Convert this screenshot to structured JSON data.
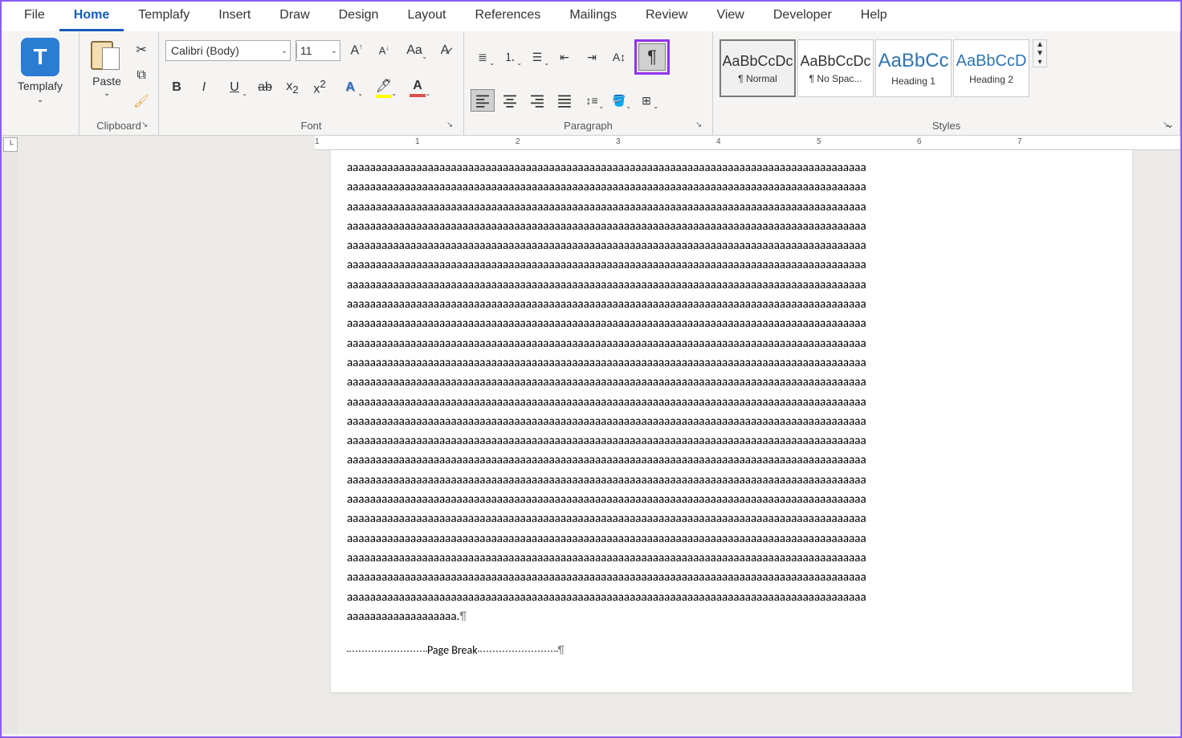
{
  "menu": {
    "items": [
      "File",
      "Home",
      "Templafy",
      "Insert",
      "Draw",
      "Design",
      "Layout",
      "References",
      "Mailings",
      "Review",
      "View",
      "Developer",
      "Help"
    ],
    "active_index": 1
  },
  "ribbon": {
    "templafy": {
      "label": "Templafy"
    },
    "clipboard": {
      "group_label": "Clipboard",
      "paste_label": "Paste"
    },
    "font": {
      "group_label": "Font",
      "font_name": "Calibri (Body)",
      "font_size": "11",
      "case_label": "Aa"
    },
    "paragraph": {
      "group_label": "Paragraph"
    },
    "styles": {
      "group_label": "Styles",
      "items": [
        {
          "preview": "AaBbCcDc",
          "name": "¶ Normal",
          "cls": "",
          "selected": true
        },
        {
          "preview": "AaBbCcDc",
          "name": "¶ No Spac...",
          "cls": "",
          "selected": false
        },
        {
          "preview": "AaBbCc",
          "name": "Heading 1",
          "cls": "h1",
          "selected": false
        },
        {
          "preview": "AaBbCcD",
          "name": "Heading 2",
          "cls": "h2",
          "selected": false
        }
      ]
    }
  },
  "ruler": {
    "marks": [
      {
        "pos": 0,
        "label": "1"
      },
      {
        "pos": 125,
        "label": "1"
      },
      {
        "pos": 250,
        "label": "2"
      },
      {
        "pos": 375,
        "label": "3"
      },
      {
        "pos": 500,
        "label": "4"
      },
      {
        "pos": 625,
        "label": "5"
      },
      {
        "pos": 750,
        "label": "6"
      },
      {
        "pos": 875,
        "label": "7"
      }
    ]
  },
  "document": {
    "line": "aaaaaaaaaaaaaaaaaaaaaaaaaaaaaaaaaaaaaaaaaaaaaaaaaaaaaaaaaaaaaaaaaaaaaaaaaaaaaaaaaaaaaaaaaa",
    "line_count": 23,
    "last_line": "aaaaaaaaaaaaaaaaaaa.¶",
    "page_break_label": "Page Break"
  }
}
